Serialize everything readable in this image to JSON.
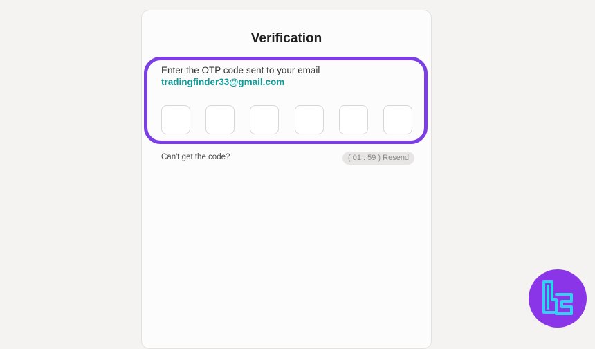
{
  "verification": {
    "title": "Verification",
    "prompt": "Enter the OTP code sent to your email",
    "email": "tradingfinder33@gmail.com",
    "otp_digits": [
      "",
      "",
      "",
      "",
      "",
      ""
    ],
    "cant_get_code": "Can't get the code?",
    "resend_label": "( 01 : 59 ) Resend"
  },
  "colors": {
    "highlight": "#7b3fe4",
    "email": "#119b98",
    "logo_bg": "#8a36e8",
    "logo_fg": "#2fd3f0"
  },
  "logo": {
    "icon": "tradingfinder-logo-icon"
  }
}
